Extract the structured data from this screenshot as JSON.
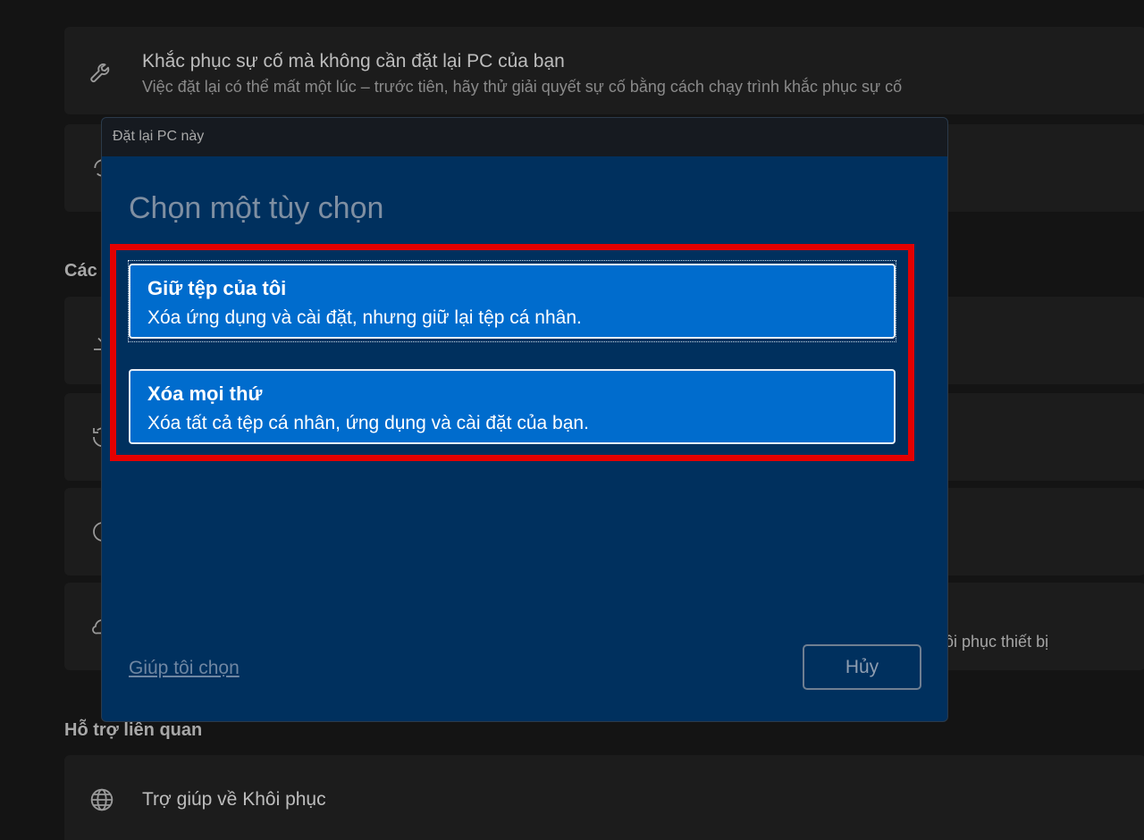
{
  "background": {
    "troubleshoot": {
      "title": "Khắc phục sự cố mà không cần đặt lại PC của bạn",
      "subtitle": "Việc đặt lại có thể mất một lúc – trước tiên, hãy thử giải quyết sự cố bằng cách chạy trình khắc phục sự cố",
      "icon": "wrench-icon"
    },
    "section_partial": "Các",
    "right_partial": "ôi phục thiết bị",
    "related_heading": "Hỗ trợ liên quan",
    "help_item": {
      "label": "Trợ giúp về Khôi phục",
      "icon": "globe-icon"
    }
  },
  "dialog": {
    "window_title": "Đặt lại PC này",
    "heading": "Chọn một tùy chọn",
    "options": [
      {
        "title": "Giữ tệp của tôi",
        "description": "Xóa ứng dụng và cài đặt, nhưng giữ lại tệp cá nhân."
      },
      {
        "title": "Xóa mọi thứ",
        "description": "Xóa tất cả tệp cá nhân, ứng dụng và cài đặt của bạn."
      }
    ],
    "help_link": "Giúp tôi chọn",
    "cancel_label": "Hủy",
    "highlight_color": "#e30000",
    "accent_color": "#006ccd"
  }
}
